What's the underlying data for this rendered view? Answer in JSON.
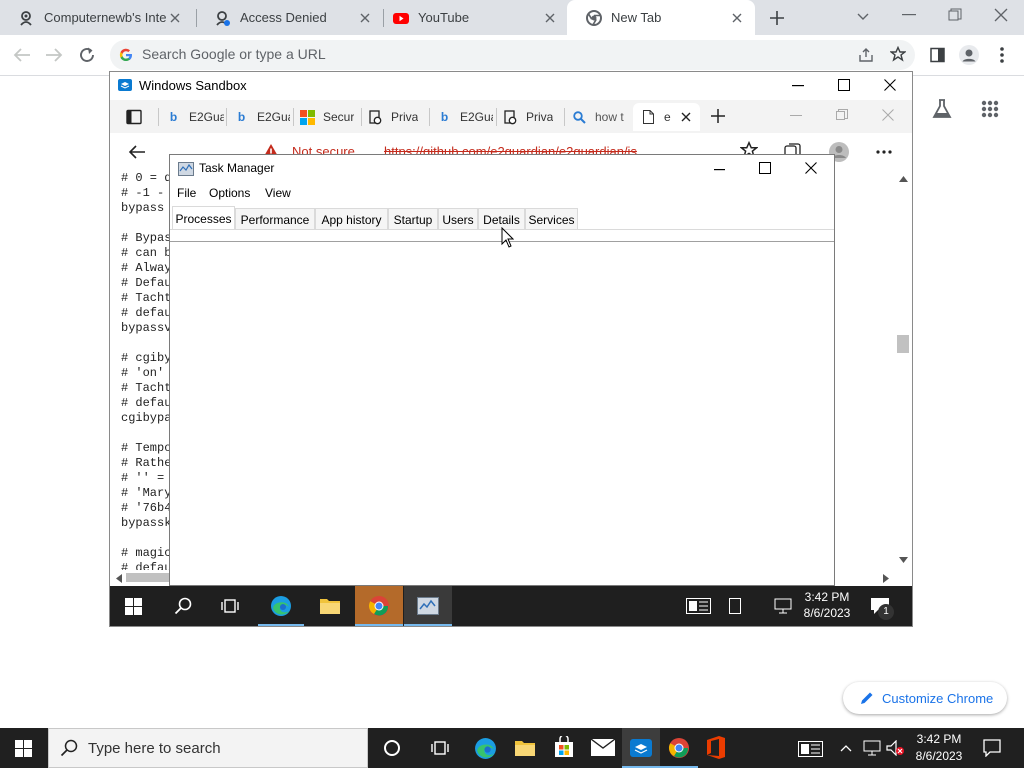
{
  "chrome": {
    "tabs": [
      {
        "title": "Computernewb's Intern"
      },
      {
        "title": "Access Denied"
      },
      {
        "title": "YouTube"
      },
      {
        "title": "New Tab"
      }
    ],
    "omnibox_placeholder": "Search Google or type a URL",
    "customize_label": "Customize Chrome"
  },
  "sandbox": {
    "title": "Windows Sandbox",
    "edge": {
      "tabs": [
        {
          "title": "E2Gua"
        },
        {
          "title": "E2Gua"
        },
        {
          "title": "Secur"
        },
        {
          "title": "Priva"
        },
        {
          "title": "E2Gua"
        },
        {
          "title": "Priva"
        },
        {
          "title": "how t"
        },
        {
          "title": "e"
        }
      ],
      "security_label": "Not secure",
      "url": "https://github.com/e2guardian/e2guardian/is"
    },
    "code_lines": [
      "# 0 = d",
      "# -1 -",
      "bypass",
      "",
      "# Bypas",
      "# can b",
      "# Alway",
      "# Defau",
      "# Tacht",
      "# defau",
      "bypassv",
      "",
      "# cgiby",
      "# 'on'",
      "# Tacht",
      "# defau",
      "cgibypa",
      "",
      "# Tempo",
      "# Rathe",
      "# '' =",
      "# 'Mary",
      "# '76b4",
      "bypassk",
      "",
      "# magic",
      "# defau"
    ],
    "taskbar": {
      "time": "3:42 PM",
      "date": "8/6/2023",
      "notification_count": "1"
    }
  },
  "task_manager": {
    "title": "Task Manager",
    "menu": [
      "File",
      "Options",
      "View"
    ],
    "tabs": [
      "Processes",
      "Performance",
      "App history",
      "Startup",
      "Users",
      "Details",
      "Services"
    ],
    "active_tab": "Processes"
  },
  "taskbar": {
    "search_placeholder": "Type here to search",
    "time": "3:42 PM",
    "date": "8/6/2023"
  },
  "colors": {
    "chrome_tabstrip": "#dee1e6",
    "taskbar": "#202020",
    "accent_blue": "#1a73e8",
    "not_secure_red": "#c42b1c"
  }
}
